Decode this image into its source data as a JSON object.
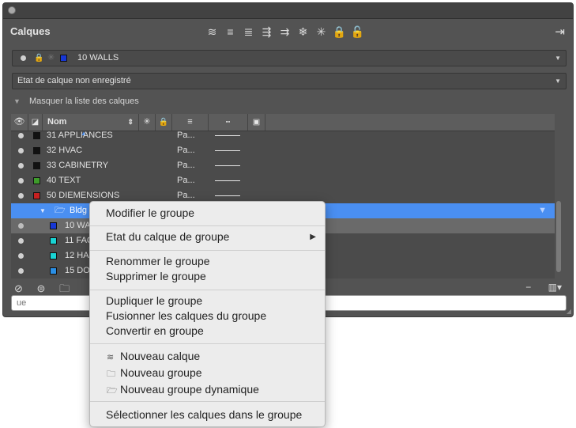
{
  "panel": {
    "title": "Calques",
    "toolbar_icons": [
      "layer-state-icon",
      "layer-properties-icon",
      "layer-match-icon",
      "layer-previous-icon",
      "layer-isolate-icon",
      "freeze-icon",
      "thaw-icon",
      "lock-icon",
      "unlock-icon"
    ],
    "current_layer": {
      "name": "10 WALLS",
      "color": "#1737d4"
    },
    "layer_state": "Etat de calque non enregistré",
    "collapse_label": "Masquer la liste des calques"
  },
  "table": {
    "headers": {
      "name": "Nom"
    },
    "rows": [
      {
        "name": "31 APPLIANCES",
        "color": "#111111",
        "plot": "Pa..."
      },
      {
        "name": "32 HVAC",
        "color": "#111111",
        "plot": "Pa..."
      },
      {
        "name": "33 CABINETRY",
        "color": "#111111",
        "plot": "Pa..."
      },
      {
        "name": "40 TEXT",
        "color": "#3e9c2b",
        "plot": "Pa..."
      },
      {
        "name": "50 DIEMENSIONS",
        "color": "#c62020",
        "plot": "Pa..."
      }
    ],
    "group_row": {
      "name": "Bldg"
    },
    "sub_rows": [
      {
        "name": "10 WA",
        "color": "#1737d4"
      },
      {
        "name": "11 FAC",
        "color": "#19d4d4"
      },
      {
        "name": "12 HA",
        "color": "#19d4d4"
      },
      {
        "name": "15 DO",
        "color": "#2a8fe6"
      }
    ]
  },
  "search": {
    "placeholder": "ue"
  },
  "context_menu": {
    "edit_group": "Modifier le groupe",
    "group_state": "Etat du calque de groupe",
    "rename_group": "Renommer le groupe",
    "delete_group": "Supprimer le groupe",
    "duplicate_group": "Dupliquer le groupe",
    "merge_group": "Fusionner les calques du groupe",
    "convert_group": "Convertir en groupe",
    "new_layer": "Nouveau calque",
    "new_group": "Nouveau groupe",
    "new_dynamic_group": "Nouveau groupe dynamique",
    "select_layers": "Sélectionner les calques dans le groupe"
  }
}
